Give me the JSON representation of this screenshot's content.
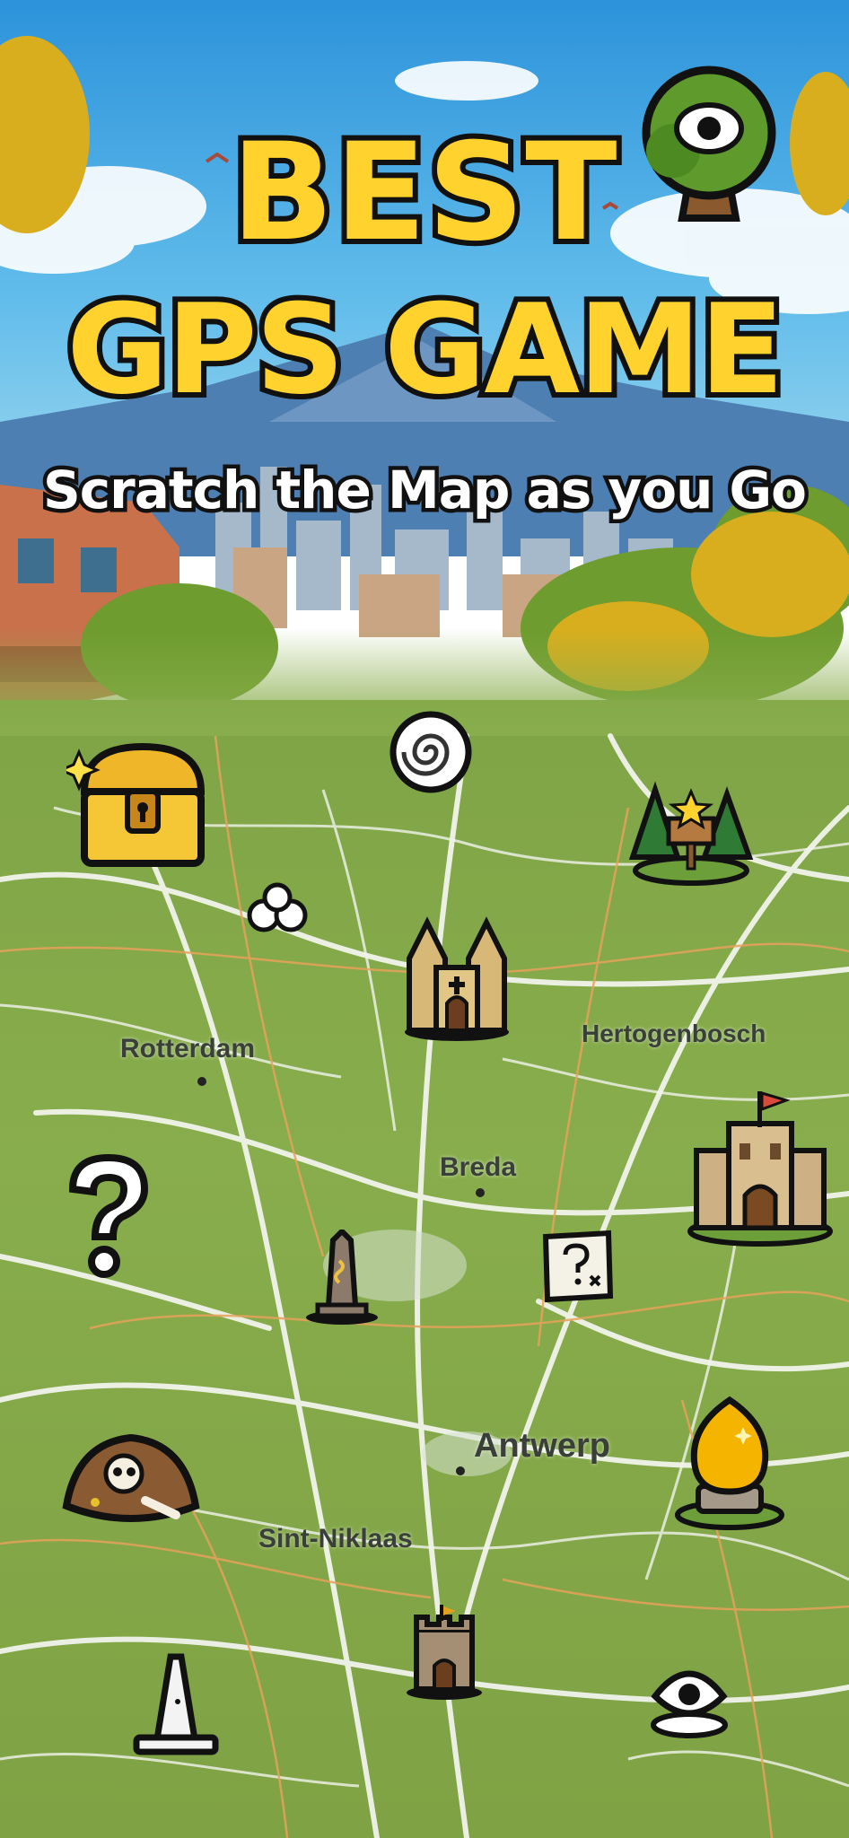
{
  "headline": {
    "line1": "BEST",
    "line2": "GPS GAME",
    "subtitle": "Scratch the Map as you Go"
  },
  "map": {
    "cities": [
      "Rotterdam",
      "Hertogenbosch",
      "Breda",
      "Antwerp",
      "Sint-Niklaas"
    ]
  },
  "markers": [
    "eye-tree-icon",
    "swirl-portal-icon",
    "treasure-chest-icon",
    "forest-sign-icon",
    "stones-icon",
    "cathedral-icon",
    "castle-flag-icon",
    "question-mark-icon",
    "obelisk-icon",
    "mystery-map-icon",
    "skull-dig-icon",
    "golden-egg-icon",
    "small-tower-icon",
    "stone-spire-icon",
    "eye-stone-icon"
  ],
  "colors": {
    "title_fill": "#FFD22E",
    "outline": "#111111",
    "map_green": "#86A84A",
    "sky_blue": "#3FA3E0"
  }
}
